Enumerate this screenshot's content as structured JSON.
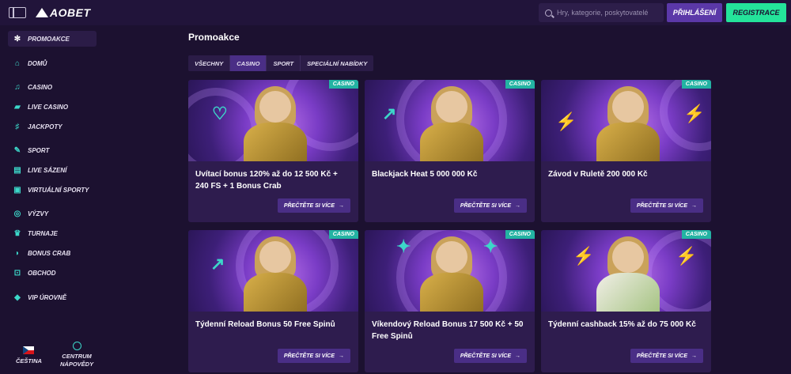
{
  "header": {
    "brand": "AOBET",
    "search_placeholder": "Hry, kategorie, poskytovatelé",
    "login_label": "PŘIHLÁŠENÍ",
    "register_label": "REGISTRACE"
  },
  "colors": {
    "background": "#1c1130",
    "topbar": "#21143a",
    "accent_purple": "#5b38a8",
    "register_green": "#24e39a",
    "badge_teal": "#23b3a3",
    "icon_teal": "#3cd7c9"
  },
  "sidebar": {
    "items": [
      {
        "label": "PROMOAKCE",
        "icon": "promo-icon",
        "active": true
      },
      {
        "label": "DOMŮ",
        "icon": "home-icon"
      },
      {
        "label": "CASINO",
        "icon": "casino-icon"
      },
      {
        "label": "LIVE CASINO",
        "icon": "live-casino-icon"
      },
      {
        "label": "JACKPOTY",
        "icon": "jackpot-icon"
      },
      {
        "label": "SPORT",
        "icon": "sport-icon"
      },
      {
        "label": "LIVE SÁZENÍ",
        "icon": "live-betting-icon"
      },
      {
        "label": "VIRTUÁLNÍ SPORTY",
        "icon": "virtual-sports-icon"
      },
      {
        "label": "VÝZVY",
        "icon": "challenges-icon"
      },
      {
        "label": "TURNAJE",
        "icon": "tournaments-icon"
      },
      {
        "label": "BONUS CRAB",
        "icon": "bonus-crab-icon"
      },
      {
        "label": "OBCHOD",
        "icon": "shop-icon"
      },
      {
        "label": "VIP ÚROVNĚ",
        "icon": "vip-icon"
      }
    ],
    "language_label": "ČEŠTINA",
    "help_label_1": "CENTRUM",
    "help_label_2": "NÁPOVĚDY"
  },
  "main": {
    "title": "Promoakce",
    "tabs": [
      {
        "label": "VŠECHNY"
      },
      {
        "label": "CASINO",
        "active": true
      },
      {
        "label": "SPORT"
      },
      {
        "label": "SPECIÁLNÍ NABÍDKY"
      }
    ],
    "cards": [
      {
        "badge": "CASINO",
        "title": "Uvítací bonus 120% až do 12 500 Kč + 240 FS + 1 Bonus Crab",
        "button": "PŘEČTĚTE SI VÍCE"
      },
      {
        "badge": "CASINO",
        "title": "Blackjack Heat 5 000 000 Kč",
        "button": "PŘEČTĚTE SI VÍCE"
      },
      {
        "badge": "CASINO",
        "title": "Závod v Ruletě 200 000 Kč",
        "button": "PŘEČTĚTE SI VÍCE"
      },
      {
        "badge": "CASINO",
        "title": "Týdenní Reload Bonus 50 Free Spinů",
        "button": "PŘEČTĚTE SI VÍCE"
      },
      {
        "badge": "CASINO",
        "title": "Víkendový Reload Bonus 17 500 Kč + 50 Free Spinů",
        "button": "PŘEČTĚTE SI VÍCE"
      },
      {
        "badge": "CASINO",
        "title": "Týdenní cashback 15% až do 75 000 Kč",
        "button": "PŘEČTĚTE SI VÍCE"
      }
    ]
  }
}
